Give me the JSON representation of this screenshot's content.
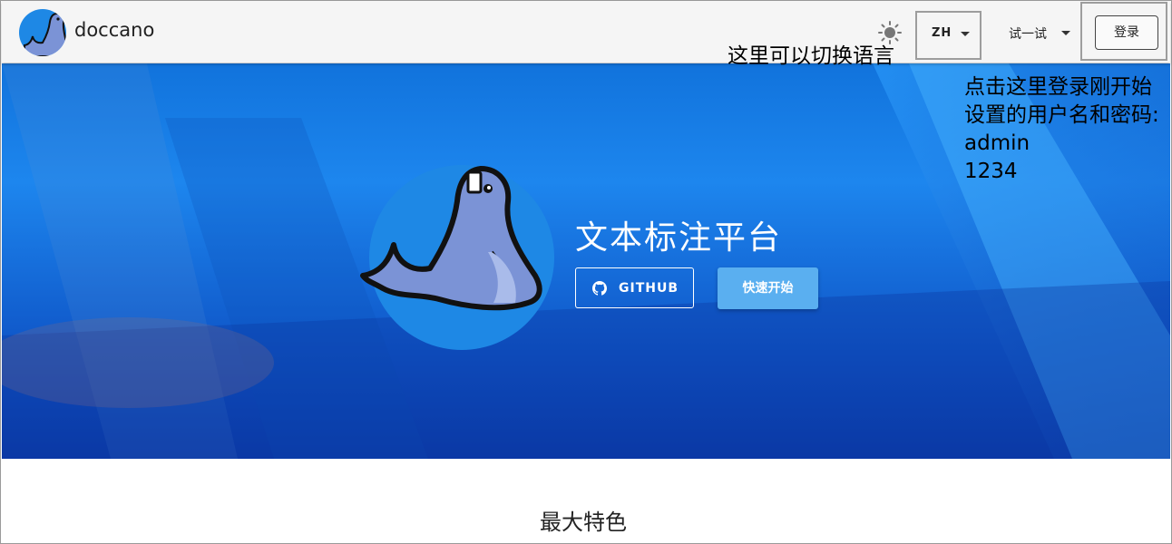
{
  "appbar": {
    "brand": "doccano",
    "theme_icon": "sun-icon",
    "language": {
      "label": "ZH"
    },
    "try_menu": {
      "label": "试一试"
    },
    "login": {
      "label": "登录"
    }
  },
  "annotations": {
    "language_note": "这里可以切换语言",
    "login_note_lines": [
      "点击这里登录刚开始",
      "设置的用户名和密码:",
      "admin",
      "1234"
    ]
  },
  "hero": {
    "title": "文本标注平台",
    "github_button": "GITHUB",
    "quickstart_button": "快速开始",
    "colors": {
      "primary": "#1e88e5",
      "start_button": "#5aaff0"
    }
  },
  "features": {
    "title": "最大特色"
  }
}
